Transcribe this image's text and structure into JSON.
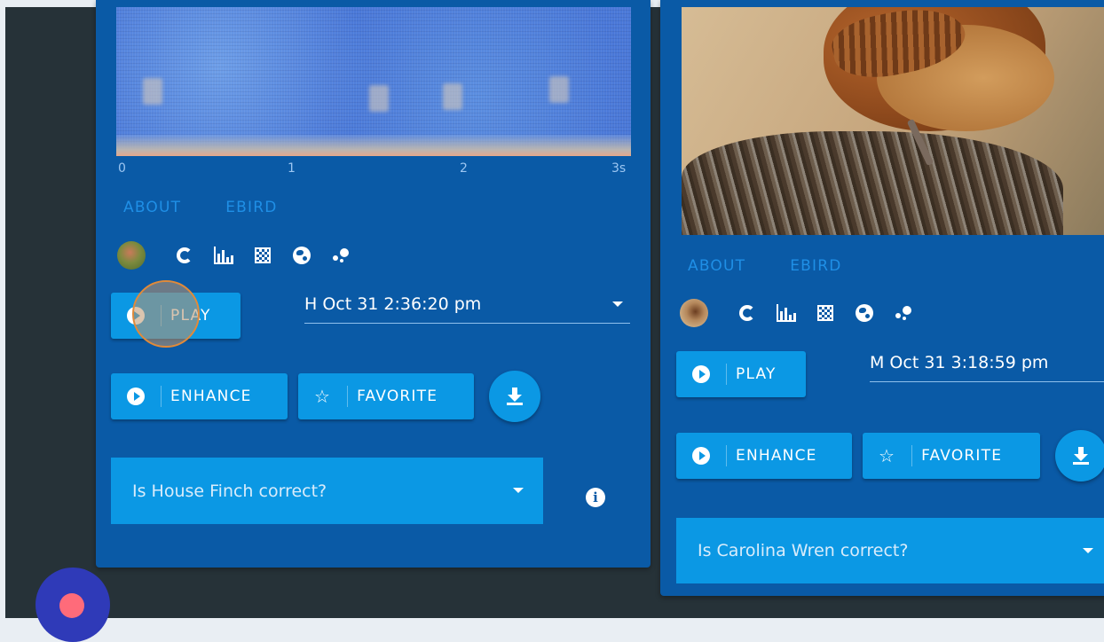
{
  "card1": {
    "axis": [
      "0",
      "1",
      "2",
      "3s"
    ],
    "links": {
      "about": "ABOUT",
      "ebird": "EBIRD"
    },
    "icons": [
      "bird-avatar",
      "circle-chart",
      "bar-chart",
      "checker-grid",
      "globe",
      "scatter-dots"
    ],
    "play_label": "PLAY",
    "time_value": "H Oct 31 2:36:20 pm",
    "enhance_label": "ENHANCE",
    "favorite_label": "FAVORITE",
    "question_text": "Is House Finch correct?"
  },
  "card2": {
    "links": {
      "about": "ABOUT",
      "ebird": "EBIRD"
    },
    "icons": [
      "bird-avatar",
      "circle-chart",
      "bar-chart",
      "checker-grid",
      "globe",
      "scatter-dots"
    ],
    "play_label": "PLAY",
    "time_value": "M Oct 31 3:18:59 pm",
    "enhance_label": "ENHANCE",
    "favorite_label": "FAVORITE",
    "question_text": "Is Carolina Wren correct?"
  },
  "colors": {
    "card_bg": "#0a5aa6",
    "button_bg": "#0b98e4",
    "link": "#1f8fe6",
    "page_bg": "#263238",
    "record_fab": "#2f3ab8",
    "record_dot": "#ff6b7a"
  }
}
